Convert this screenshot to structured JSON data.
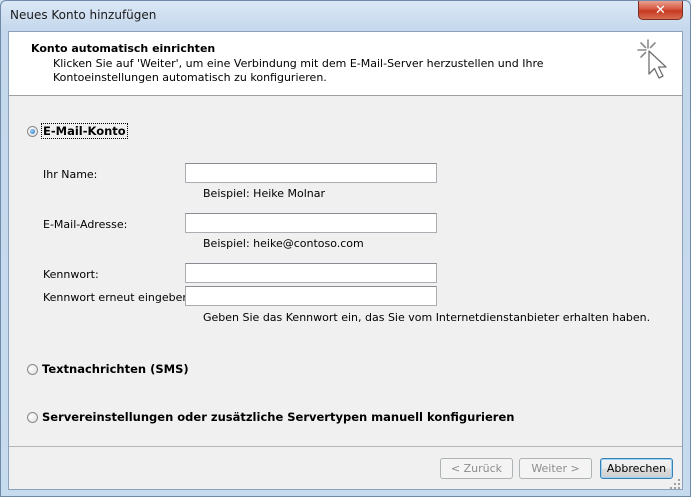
{
  "window": {
    "title": "Neues Konto hinzufügen",
    "close_symbol": "✕"
  },
  "header": {
    "title": "Konto automatisch einrichten",
    "description": "Klicken Sie auf 'Weiter', um eine Verbindung mit dem E-Mail-Server herzustellen und Ihre Kontoeinstellungen automatisch zu konfigurieren."
  },
  "options": {
    "email": {
      "label": "E-Mail-Konto",
      "selected": true
    },
    "sms": {
      "label": "Textnachrichten (SMS)",
      "selected": false
    },
    "manual": {
      "label": "Servereinstellungen oder zusätzliche Servertypen manuell konfigurieren",
      "selected": false
    }
  },
  "form": {
    "name": {
      "label": "Ihr Name:",
      "value": "",
      "hint": "Beispiel: Heike Molnar"
    },
    "email": {
      "label": "E-Mail-Adresse:",
      "value": "",
      "hint": "Beispiel: heike@contoso.com"
    },
    "password": {
      "label": "Kennwort:",
      "value": ""
    },
    "password_confirm": {
      "label": "Kennwort erneut eingeben:",
      "value": ""
    },
    "password_hint": "Geben Sie das Kennwort ein, das Sie vom Internetdienstanbieter erhalten haben."
  },
  "buttons": {
    "back": "< Zurück",
    "next": "Weiter >",
    "cancel": "Abbrechen"
  },
  "colors": {
    "accent": "#3c7fb1",
    "close": "#c63a22",
    "title_bg": "#c4d7ec"
  },
  "icons": {
    "wizard": "sparkle-cursor-icon",
    "close": "close-icon",
    "resize": "resize-grip-icon"
  }
}
